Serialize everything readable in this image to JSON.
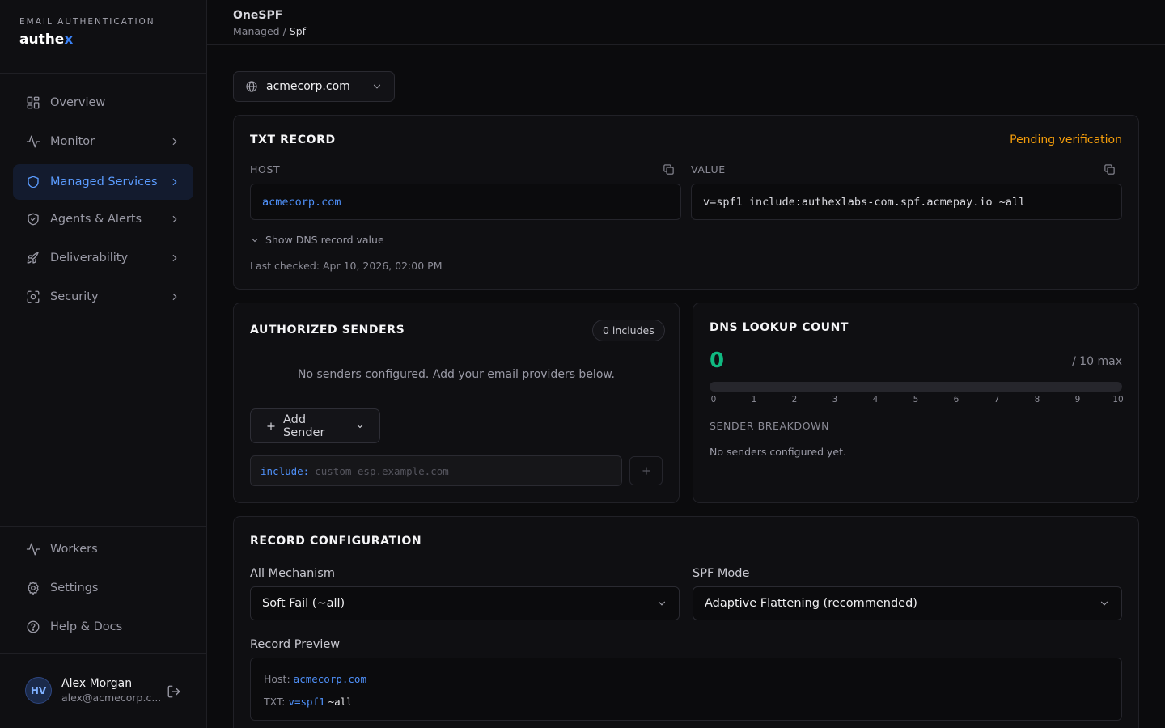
{
  "brand": {
    "kicker": "EMAIL AUTHENTICATION",
    "name_main": "authe",
    "name_accent": "x"
  },
  "sidebar": {
    "items": [
      {
        "label": "Overview",
        "icon": "grid-icon",
        "chevron": false,
        "active": false
      },
      {
        "label": "Monitor",
        "icon": "pulse-icon",
        "chevron": true,
        "active": false
      },
      {
        "label": "Managed Services",
        "icon": "shield-icon",
        "chevron": true,
        "active": true
      },
      {
        "label": "Agents & Alerts",
        "icon": "shield-check-icon",
        "chevron": true,
        "active": false
      },
      {
        "label": "Deliverability",
        "icon": "rocket-icon",
        "chevron": true,
        "active": false
      },
      {
        "label": "Security",
        "icon": "scan-icon",
        "chevron": true,
        "active": false
      }
    ],
    "bottom_items": [
      {
        "label": "Workers",
        "icon": "pulse-icon"
      },
      {
        "label": "Settings",
        "icon": "gear-icon"
      },
      {
        "label": "Help & Docs",
        "icon": "help-circle-icon"
      }
    ],
    "user": {
      "initials": "HV",
      "name": "Alex Morgan",
      "email": "alex@acmecorp.c..."
    }
  },
  "header": {
    "title": "OneSPF",
    "breadcrumb_parent": "Managed",
    "breadcrumb_sep": " / ",
    "breadcrumb_current": "Spf"
  },
  "domain_select": {
    "value": "acmecorp.com"
  },
  "txt_record": {
    "title": "TXT RECORD",
    "status": "Pending verification",
    "host_label": "HOST",
    "host_value": "acmecorp.com",
    "value_label": "VALUE",
    "value": "v=spf1 include:authexlabs-com.spf.acmepay.io ~all",
    "toggle_label": "Show DNS record value",
    "last_checked": "Last checked: Apr 10, 2026, 02:00 PM"
  },
  "authorized_senders": {
    "title": "AUTHORIZED SENDERS",
    "badge": "0 includes",
    "empty_message": "No senders configured. Add your email providers below.",
    "add_button": "Add Sender",
    "include_prefix": "include:",
    "include_placeholder": "custom-esp.example.com"
  },
  "dns_lookup": {
    "title": "DNS LOOKUP COUNT",
    "count": "0",
    "max_label": "/ 10 max",
    "used": 0,
    "max": 10,
    "ticks": [
      "0",
      "1",
      "2",
      "3",
      "4",
      "5",
      "6",
      "7",
      "8",
      "9",
      "10"
    ],
    "breakdown_label": "SENDER BREAKDOWN",
    "breakdown_empty": "No senders configured yet."
  },
  "record_config": {
    "title": "RECORD CONFIGURATION",
    "all_mechanism_label": "All Mechanism",
    "all_mechanism_value": "Soft Fail (~all)",
    "spf_mode_label": "SPF Mode",
    "spf_mode_value": "Adaptive Flattening (recommended)",
    "preview_label": "Record Preview",
    "preview_host_label": "Host:",
    "preview_host_value": "acmecorp.com",
    "preview_txt_label": "TXT:",
    "preview_txt_version": "v=spf1",
    "preview_txt_all": "~all"
  },
  "colors": {
    "accent": "#4e8ff7",
    "pending": "#f59e0b",
    "success": "#10b981",
    "background": "#0b0b0d"
  }
}
